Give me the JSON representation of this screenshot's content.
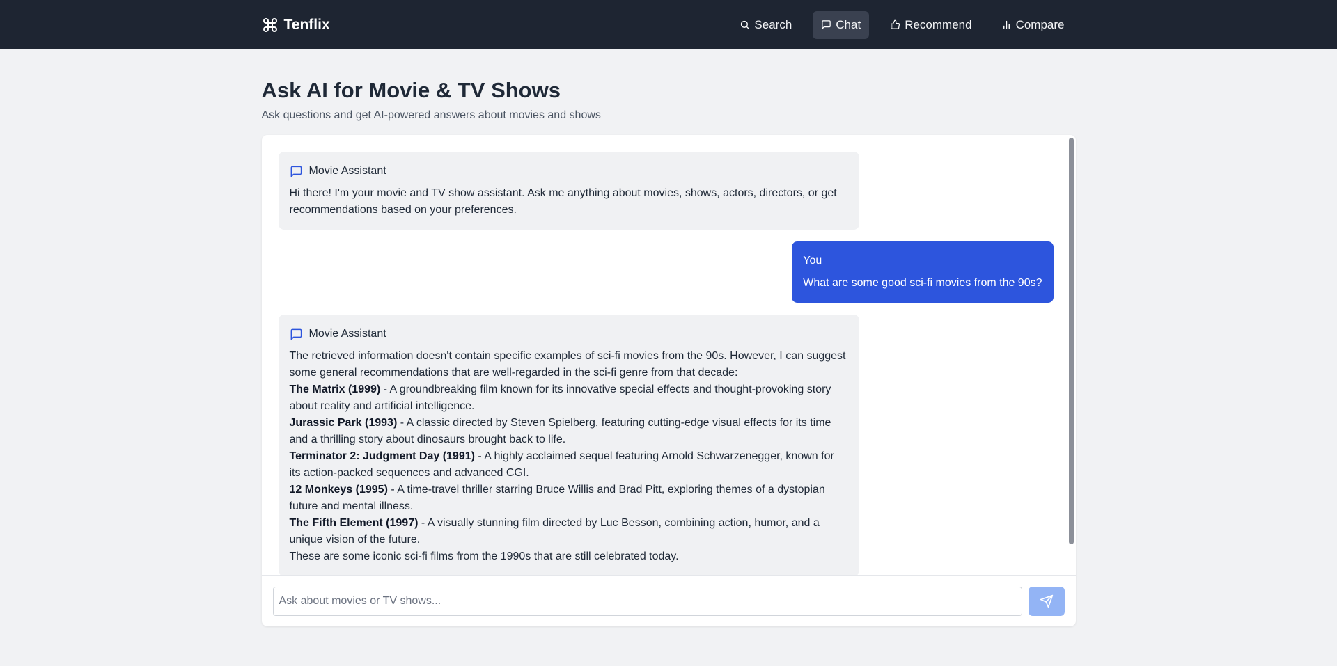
{
  "nav": {
    "brand": "Tenflix",
    "brand_icon": "command-icon",
    "links": [
      {
        "label": "Search",
        "icon": "search-icon"
      },
      {
        "label": "Chat",
        "icon": "chat-icon",
        "active": true
      },
      {
        "label": "Recommend",
        "icon": "thumbs-up-icon"
      },
      {
        "label": "Compare",
        "icon": "bar-chart-icon"
      }
    ]
  },
  "page": {
    "title": "Ask AI for Movie & TV Shows",
    "subtitle": "Ask questions and get AI-powered answers about movies and shows"
  },
  "messages": [
    {
      "role": "bot",
      "sender": "Movie Assistant",
      "text": "Hi there! I'm your movie and TV show assistant. Ask me anything about movies, shows, actors, directors, or get recommendations based on your preferences."
    },
    {
      "role": "user",
      "sender": "You",
      "text": "What are some good sci-fi movies from the 90s?"
    },
    {
      "role": "bot",
      "sender": "Movie Assistant",
      "intro": "The retrieved information doesn't contain specific examples of sci-fi movies from the 90s. However, I can suggest some general recommendations that are well-regarded in the sci-fi genre from that decade:",
      "items": [
        {
          "title": "The Matrix (1999)",
          "desc": " - A groundbreaking film known for its innovative special effects and thought-provoking story about reality and artificial intelligence."
        },
        {
          "title": "Jurassic Park (1993)",
          "desc": " - A classic directed by Steven Spielberg, featuring cutting-edge visual effects for its time and a thrilling story about dinosaurs brought back to life."
        },
        {
          "title": "Terminator 2: Judgment Day (1991)",
          "desc": " - A highly acclaimed sequel featuring Arnold Schwarzenegger, known for its action-packed sequences and advanced CGI."
        },
        {
          "title": "12 Monkeys (1995)",
          "desc": " - A time-travel thriller starring Bruce Willis and Brad Pitt, exploring themes of a dystopian future and mental illness."
        },
        {
          "title": "The Fifth Element (1997)",
          "desc": " - A visually stunning film directed by Luc Besson, combining action, humor, and a unique vision of the future."
        }
      ],
      "outro": "These are some iconic sci-fi films from the 1990s that are still celebrated today."
    }
  ],
  "input": {
    "placeholder": "Ask about movies or TV shows...",
    "value": ""
  },
  "colors": {
    "navbar": "#1e2532",
    "user_bubble": "#2d55dd",
    "send_button": "#93b4f5",
    "bot_icon": "#2d55dd"
  }
}
